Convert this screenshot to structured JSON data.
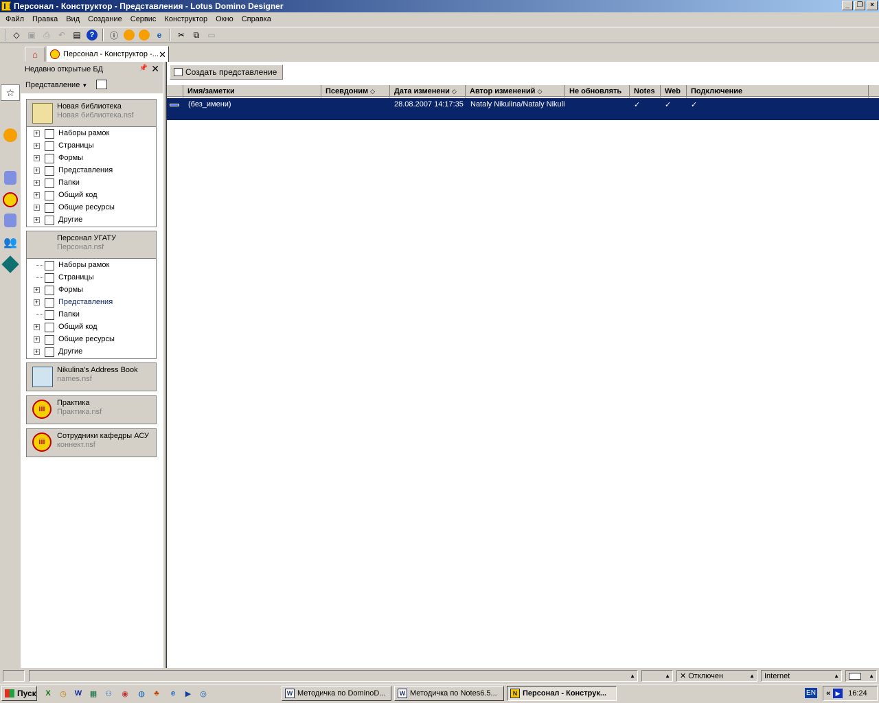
{
  "window": {
    "title": "Персонал - Конструктор - Представления - Lotus Domino Designer"
  },
  "menu": [
    "Файл",
    "Правка",
    "Вид",
    "Создание",
    "Сервис",
    "Конструктор",
    "Окно",
    "Справка"
  ],
  "tab": {
    "label": "Персонал - Конструктор -..."
  },
  "navigator": {
    "title": "Недавно открытые БД",
    "view_label": "Представление",
    "databases": [
      {
        "title": "Новая библиотека",
        "file": "Новая библиотека.nsf",
        "items": [
          "Наборы рамок",
          "Страницы",
          "Формы",
          "Представления",
          "Папки",
          "Общий код",
          "Общие ресурсы",
          "Другие"
        ]
      },
      {
        "title": "Персонал УГАТУ",
        "file": "Персонал.nsf",
        "items": [
          "Наборы рамок",
          "Страницы",
          "Формы",
          "Представления",
          "Папки",
          "Общий код",
          "Общие ресурсы",
          "Другие"
        ]
      },
      {
        "title": "Nikulina's Address Book",
        "file": "names.nsf"
      },
      {
        "title": "Практика",
        "file": "Практика.nsf"
      },
      {
        "title": "Сотрудники кафедры АСУ",
        "file": "коннект.nsf"
      }
    ]
  },
  "main": {
    "action_button": "Создать представление",
    "columns": [
      "Имя/заметки",
      "Псевдоним",
      "Дата изменени",
      "Автор изменений",
      "Не обновлять",
      "Notes",
      "Web",
      "Подключение"
    ],
    "rows": [
      {
        "name": "(без_имени)",
        "alias": "",
        "date": "28.08.2007 14:17:35",
        "author": "Nataly Nikulina/Nataly Nikuli",
        "no_update": "",
        "notes": "✓",
        "web": "✓",
        "connect": "✓"
      }
    ],
    "selection_color": "#0a246a"
  },
  "status": {
    "connection": "Отключен",
    "zone": "Internet"
  },
  "taskbar": {
    "start": "Пуск",
    "tasks": [
      "Методичка по DominoD...",
      "Методичка по Notes6.5...",
      "Персонал - Конструк..."
    ],
    "lang": "EN",
    "time": "16:24"
  }
}
